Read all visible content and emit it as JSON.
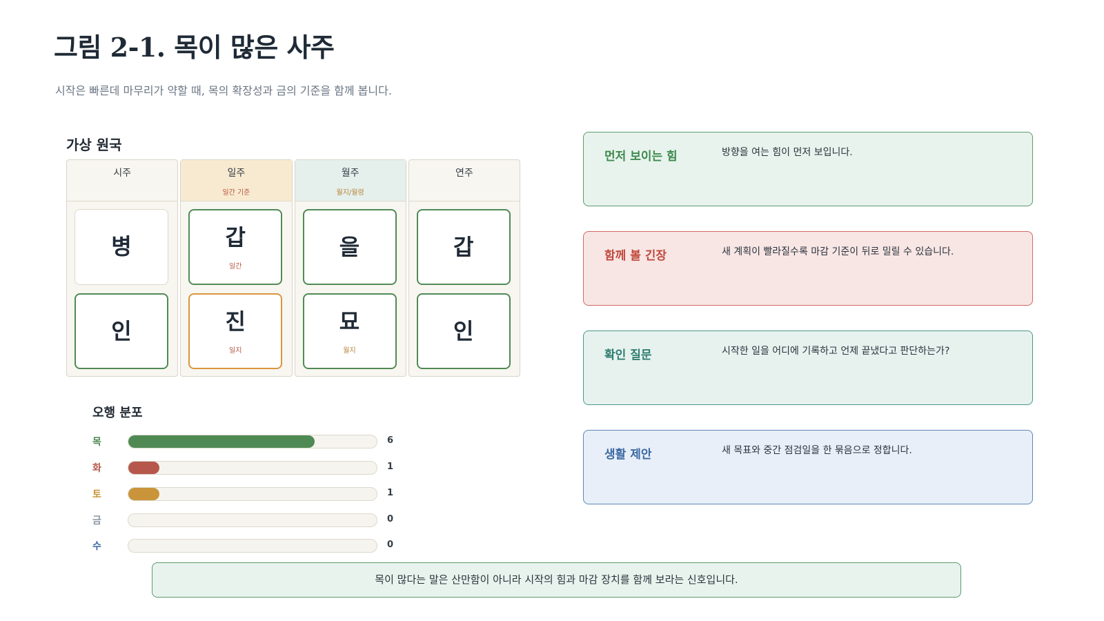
{
  "title": "그림 2-1. 목이 많은 사주",
  "subtitle": "시작은 빠른데 마무리가 약할 때, 목의 확장성과 금의 기준을 함께 봅니다.",
  "pillar_chart": {
    "title": "가상 원국",
    "pillars": [
      {
        "name": "시주",
        "note": "",
        "top": "병",
        "top_note": "",
        "bottom": "인",
        "bottom_note": ""
      },
      {
        "name": "일주",
        "note": "일간 기준",
        "top": "갑",
        "top_note": "일간",
        "bottom": "진",
        "bottom_note": "일지"
      },
      {
        "name": "월주",
        "note": "월지/월령",
        "top": "을",
        "top_note": "",
        "bottom": "묘",
        "bottom_note": "월지"
      },
      {
        "name": "연주",
        "note": "",
        "top": "갑",
        "top_note": "",
        "bottom": "인",
        "bottom_note": ""
      }
    ]
  },
  "distribution": {
    "title": "오행 분포",
    "max": 8,
    "items": [
      {
        "label": "목",
        "count": "6",
        "value": 6,
        "color": "#4f8a55",
        "label_color": "#4f8a55"
      },
      {
        "label": "화",
        "count": "1",
        "value": 1,
        "color": "#b5574b",
        "label_color": "#b5574b"
      },
      {
        "label": "토",
        "count": "1",
        "value": 1,
        "color": "#c9943a",
        "label_color": "#c9943a"
      },
      {
        "label": "금",
        "count": "0",
        "value": 0,
        "color": "#8a96a3",
        "label_color": "#8a96a3"
      },
      {
        "label": "수",
        "count": "0",
        "value": 0,
        "color": "#3b68a3",
        "label_color": "#3b68a3"
      }
    ]
  },
  "cards": [
    {
      "title": "먼저 보이는 힘",
      "text": "방향을 여는 힘이 먼저 보입니다."
    },
    {
      "title": "함께 볼 긴장",
      "text": "새 계획이 빨라질수록 마감 기준이 뒤로 밀릴 수 있습니다."
    },
    {
      "title": "확인 질문",
      "text": "시작한 일을 어디에 기록하고 언제 끝냈다고 판단하는가?"
    },
    {
      "title": "생활 제안",
      "text": "새 목표와 중간 점검일을 한 묶음으로 정합니다."
    }
  ],
  "footer": "목이 많다는 말은 산만함이 아니라 시작의 힘과 마감 장치를 함께 보라는 신호입니다."
}
